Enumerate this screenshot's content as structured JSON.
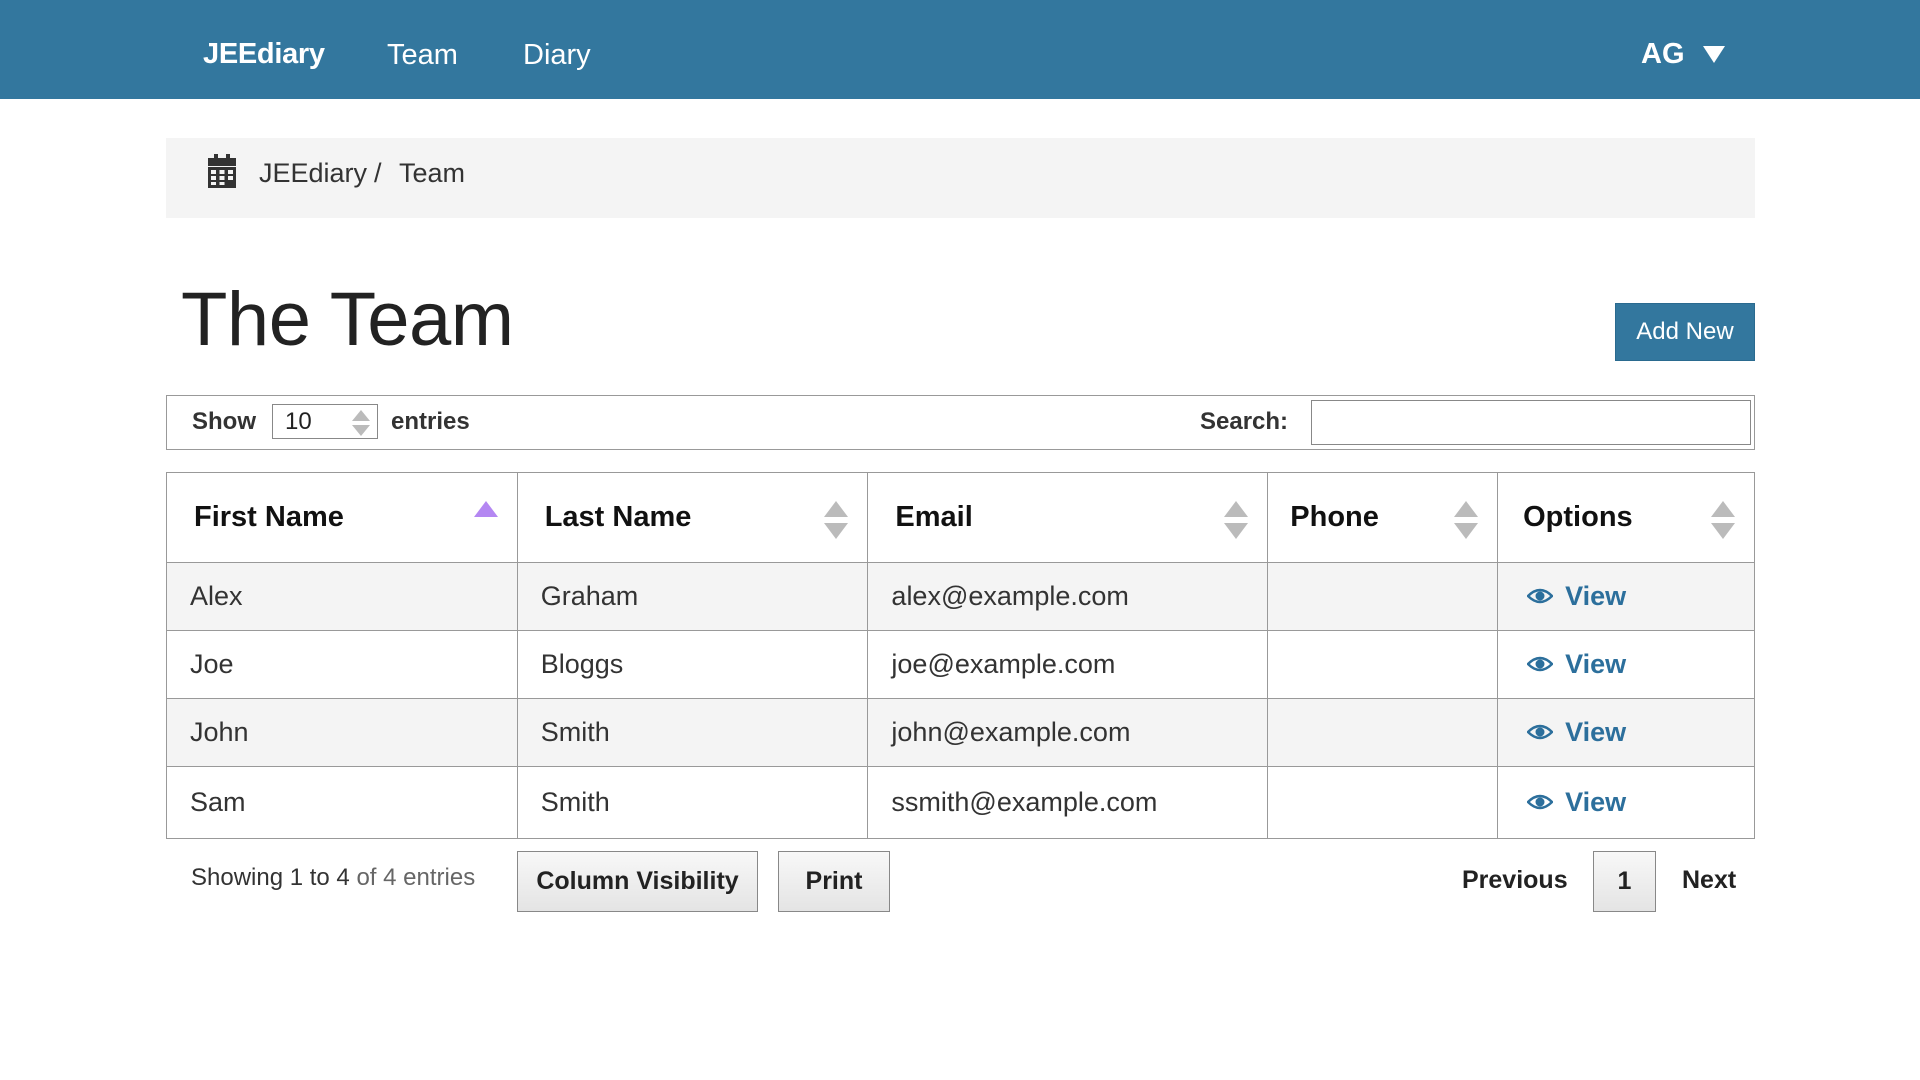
{
  "navbar": {
    "brand": "JEEdiary",
    "links": [
      "Team",
      "Diary"
    ],
    "user": "AG",
    "bg_color": "#33779e"
  },
  "breadcrumb": {
    "icon": "calendar-icon",
    "items": [
      "JEEdiary",
      "Team"
    ],
    "separator": "/"
  },
  "page": {
    "title": "The Team",
    "add_button": "Add New"
  },
  "controls": {
    "show_label": "Show",
    "page_length": "10",
    "entries_label": "entries",
    "search_label": "Search:",
    "search_value": ""
  },
  "table": {
    "columns": [
      "First Name",
      "Last Name",
      "Email",
      "Phone",
      "Options"
    ],
    "sorted_column": "First Name",
    "sort_direction": "ascending",
    "rows": [
      {
        "first": "Alex",
        "last": "Graham",
        "email": "alex@example.com",
        "phone": "",
        "option": "View"
      },
      {
        "first": "Joe",
        "last": "Bloggs",
        "email": "joe@example.com",
        "phone": "",
        "option": "View"
      },
      {
        "first": "John",
        "last": "Smith",
        "email": "john@example.com",
        "phone": "",
        "option": "View"
      },
      {
        "first": "Sam",
        "last": "Smith",
        "email": "ssmith@example.com",
        "phone": "",
        "option": "View"
      }
    ]
  },
  "footer": {
    "info_prefix": "Showing 1 to 4",
    "info_suffix": "of 4 entries",
    "column_visibility": "Column Visibility",
    "print": "Print",
    "previous": "Previous",
    "current_page": "1",
    "next": "Next"
  },
  "colors": {
    "accent": "#33779e",
    "link": "#2c6f9c",
    "sort_active": "#b487f2",
    "row_stripe": "#f4f4f4"
  }
}
